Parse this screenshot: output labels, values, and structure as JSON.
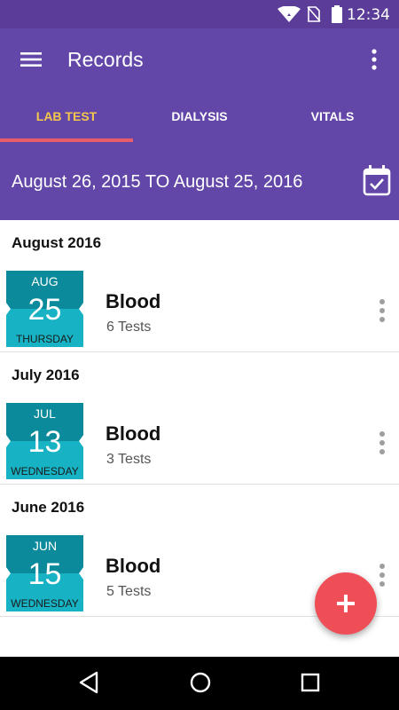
{
  "status_bar": {
    "time": "12:34"
  },
  "app_bar": {
    "title": "Records"
  },
  "tabs": [
    {
      "label": "LAB TEST",
      "active": true
    },
    {
      "label": "DIALYSIS",
      "active": false
    },
    {
      "label": "VITALS",
      "active": false
    }
  ],
  "date_range": {
    "text": "August 26, 2015 TO August 25, 2016"
  },
  "sections": [
    {
      "header": "August 2016",
      "record": {
        "month": "AUG",
        "day": "25",
        "weekday": "THURSDAY",
        "name": "Blood",
        "count": "6 Tests"
      }
    },
    {
      "header": "July 2016",
      "record": {
        "month": "JUL",
        "day": "13",
        "weekday": "WEDNESDAY",
        "name": "Blood",
        "count": "3 Tests"
      }
    },
    {
      "header": "June 2016",
      "record": {
        "month": "JUN",
        "day": "15",
        "weekday": "WEDNESDAY",
        "name": "Blood",
        "count": "5 Tests"
      }
    }
  ],
  "colors": {
    "primary": "#6247a8",
    "status_bar": "#5b3c99",
    "active_tab": "#f5c84c",
    "tab_indicator": "#e85d6a",
    "fab": "#ef4e56",
    "badge_dark": "#0b8a9b",
    "badge_light": "#17b2c3"
  },
  "icons": {
    "menu": "hamburger-menu-icon",
    "overflow": "vertical-dots-icon",
    "calendar": "calendar-check-icon",
    "fab": "plus-icon",
    "nav": [
      "back-triangle-icon",
      "home-circle-icon",
      "recents-square-icon"
    ]
  }
}
